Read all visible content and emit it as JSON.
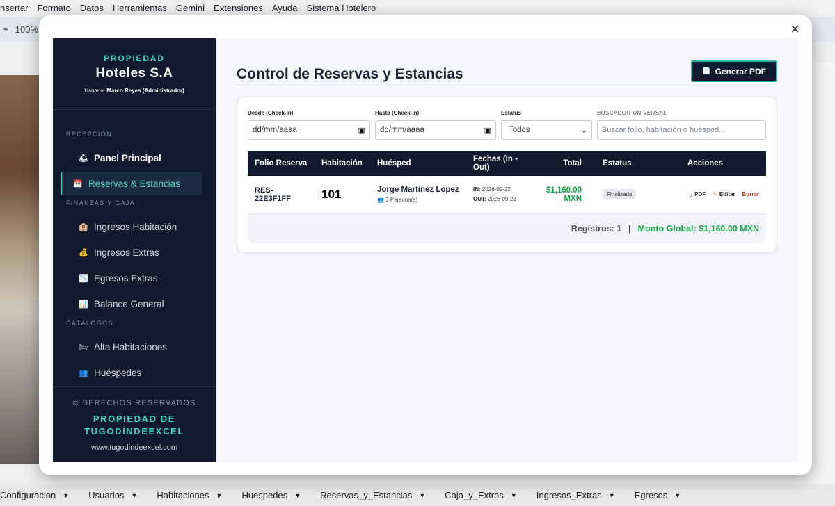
{
  "background": {
    "menubar": [
      "nsertar",
      "Formato",
      "Datos",
      "Herramientas",
      "Gemini",
      "Extensiones",
      "Ayuda",
      "Sistema Hotelero"
    ],
    "zoom": "100%",
    "sheet_tabs": [
      "Configuracion",
      "Usuarios",
      "Habitaciones",
      "Huespedes",
      "Reservas_y_Estancias",
      "Caja_y_Extras",
      "Ingresos_Extras",
      "Egresos"
    ]
  },
  "modal": {
    "close_label": "×"
  },
  "sidebar": {
    "eyebrow": "PROPIEDAD",
    "title": "Hoteles S.A",
    "user_prefix": "Usuario: ",
    "user_name": "Marco Reyes (Administrador)",
    "sections": {
      "reception": "RECEPCIÓN",
      "finance": "FINANZAS Y CAJA",
      "catalogs": "CATÁLOGOS"
    },
    "items": [
      {
        "label": "Panel Principal",
        "icon": "🛎"
      },
      {
        "label": "Reservas & Estancias",
        "icon": "📅"
      },
      {
        "label": "Ingresos Habitación",
        "icon": "🏨"
      },
      {
        "label": "Ingresos Extras",
        "icon": "💰"
      },
      {
        "label": "Egresos Extras",
        "icon": "📉"
      },
      {
        "label": "Balance General",
        "icon": "📊"
      },
      {
        "label": "Alta Habitaciones",
        "icon": "🛏"
      },
      {
        "label": "Huéspedes",
        "icon": "👥"
      }
    ],
    "footer": {
      "rights": "© DERECHOS RESERVADOS",
      "owner": "PROPIEDAD DE TUGODÍNDEEXCEL",
      "url": "www.tugodindeexcel.com"
    }
  },
  "main": {
    "title": "Control de Reservas y Estancias",
    "pdf_button": "Generar PDF",
    "filters": {
      "from_label": "Desde (Check-In)",
      "from_value": "dd/mm/aaaa",
      "to_label": "Hasta (Check-In)",
      "to_value": "dd/mm/aaaa",
      "status_label": "Estatus",
      "status_value": "Todos",
      "search_label": "BUSCADOR UNIVERSAL",
      "search_placeholder": "Buscar folio, habitación o huésped..."
    },
    "table": {
      "headers": [
        "Folio Reserva",
        "Habitación",
        "Huésped",
        "Fechas (In - Out)",
        "Total",
        "Estatus",
        "Acciones"
      ],
      "rows": [
        {
          "folio": "RES-22E3F1FF",
          "room": "101",
          "guest": "Jorge Martinez Lopez",
          "guests_count": "3 Persona(s)",
          "in_label": "IN:",
          "in_date": "2026-09-22",
          "out_label": "OUT:",
          "out_date": "2026-09-23",
          "total": "$1,160.00 MXN",
          "status": "Finalizada",
          "actions": {
            "pdf": "PDF",
            "edit": "Editar",
            "delete": "Borrar"
          }
        }
      ]
    },
    "summary": {
      "records": "Registros: 1",
      "separator": "|",
      "global": "Monto Global: $1,160.00 MXN"
    }
  }
}
